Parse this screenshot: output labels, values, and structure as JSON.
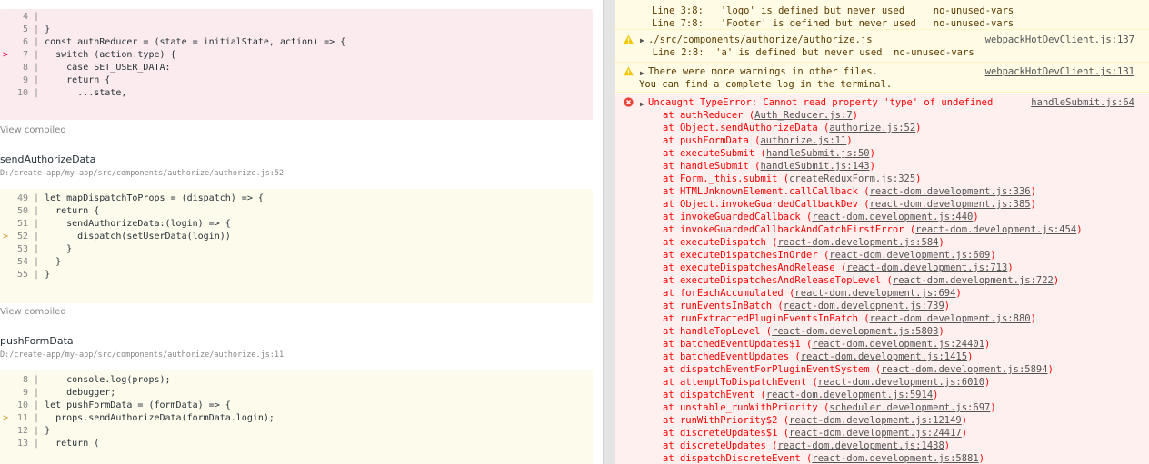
{
  "left": {
    "block1": [
      {
        "arrow": "",
        "num": "4",
        "code": ""
      },
      {
        "arrow": "",
        "num": "5",
        "code": "}"
      },
      {
        "arrow": "",
        "num": "6",
        "code": "const authReducer = (state = initialState, action) => {"
      },
      {
        "arrow": ">",
        "num": "7",
        "code": "  switch (action.type) {"
      },
      {
        "arrow": "",
        "num": "8",
        "code": "    case SET_USER_DATA:"
      },
      {
        "arrow": "",
        "num": "9",
        "code": "    return {"
      },
      {
        "arrow": "",
        "num": "10",
        "code": "      ...state,"
      }
    ],
    "view_compiled_1": "View compiled",
    "fn2_name": "sendAuthorizeData",
    "fn2_path": "D:/create-app/my-app/src/components/authorize/authorize.js:52",
    "block2": [
      {
        "arrow": "",
        "num": "49",
        "code": "let mapDispatchToProps = (dispatch) => {"
      },
      {
        "arrow": "",
        "num": "50",
        "code": "  return {"
      },
      {
        "arrow": "",
        "num": "51",
        "code": "    sendAuthorizeData:(login) => {"
      },
      {
        "arrow": ">",
        "num": "52",
        "code": "      dispatch(setUserData(login))"
      },
      {
        "arrow": "",
        "num": "53",
        "code": "    }"
      },
      {
        "arrow": "",
        "num": "54",
        "code": "  }"
      },
      {
        "arrow": "",
        "num": "55",
        "code": "}"
      }
    ],
    "view_compiled_2": "View compiled",
    "fn3_name": "pushFormData",
    "fn3_path": "D:/create-app/my-app/src/components/authorize/authorize.js:11",
    "block3": [
      {
        "arrow": "",
        "num": "8",
        "code": "    console.log(props);"
      },
      {
        "arrow": "",
        "num": "9",
        "code": "    debugger;"
      },
      {
        "arrow": "",
        "num": "10",
        "code": "let pushFormData = (formData) => {"
      },
      {
        "arrow": ">",
        "num": "11",
        "code": "  props.sendAuthorizeData(formData.login);"
      },
      {
        "arrow": "",
        "num": "12",
        "code": "}"
      },
      {
        "arrow": "",
        "num": "13",
        "code": "  return ("
      }
    ]
  },
  "console": {
    "warn_top": {
      "line1": "Line 3:8:   'logo' is defined but never used     no-unused-vars",
      "line2": "Line 7:8:   'Footer' is defined but never used   no-unused-vars"
    },
    "warn_authorize": {
      "title": "./src/components/authorize/authorize.js",
      "source": "webpackHotDevClient.js:137",
      "detail": "  Line 2:8:  'a' is defined but never used  no-unused-vars"
    },
    "warn_more": {
      "title": "There were more warnings in other files.",
      "source": "webpackHotDevClient.js:131",
      "detail": "You can find a complete log in the terminal."
    },
    "error": {
      "title": "Uncaught TypeError: Cannot read property 'type' of undefined",
      "source": "handleSubmit.js:64",
      "frames": [
        {
          "fn": "at authReducer",
          "loc": "Auth_Reducer.js:7"
        },
        {
          "fn": "at Object.sendAuthorizeData",
          "loc": "authorize.js:52"
        },
        {
          "fn": "at pushFormData",
          "loc": "authorize.js:11"
        },
        {
          "fn": "at executeSubmit",
          "loc": "handleSubmit.js:50"
        },
        {
          "fn": "at handleSubmit",
          "loc": "handleSubmit.js:143"
        },
        {
          "fn": "at Form._this.submit",
          "loc": "createReduxForm.js:325"
        },
        {
          "fn": "at HTMLUnknownElement.callCallback",
          "loc": "react-dom.development.js:336"
        },
        {
          "fn": "at Object.invokeGuardedCallbackDev",
          "loc": "react-dom.development.js:385"
        },
        {
          "fn": "at invokeGuardedCallback",
          "loc": "react-dom.development.js:440"
        },
        {
          "fn": "at invokeGuardedCallbackAndCatchFirstError",
          "loc": "react-dom.development.js:454"
        },
        {
          "fn": "at executeDispatch",
          "loc": "react-dom.development.js:584"
        },
        {
          "fn": "at executeDispatchesInOrder",
          "loc": "react-dom.development.js:609"
        },
        {
          "fn": "at executeDispatchesAndRelease",
          "loc": "react-dom.development.js:713"
        },
        {
          "fn": "at executeDispatchesAndReleaseTopLevel",
          "loc": "react-dom.development.js:722"
        },
        {
          "fn": "at forEachAccumulated",
          "loc": "react-dom.development.js:694"
        },
        {
          "fn": "at runEventsInBatch",
          "loc": "react-dom.development.js:739"
        },
        {
          "fn": "at runExtractedPluginEventsInBatch",
          "loc": "react-dom.development.js:880"
        },
        {
          "fn": "at handleTopLevel",
          "loc": "react-dom.development.js:5803"
        },
        {
          "fn": "at batchedEventUpdates$1",
          "loc": "react-dom.development.js:24401"
        },
        {
          "fn": "at batchedEventUpdates",
          "loc": "react-dom.development.js:1415"
        },
        {
          "fn": "at dispatchEventForPluginEventSystem",
          "loc": "react-dom.development.js:5894"
        },
        {
          "fn": "at attemptToDispatchEvent",
          "loc": "react-dom.development.js:6010"
        },
        {
          "fn": "at dispatchEvent",
          "loc": "react-dom.development.js:5914"
        },
        {
          "fn": "at unstable_runWithPriority",
          "loc": "scheduler.development.js:697"
        },
        {
          "fn": "at runWithPriority$2",
          "loc": "react-dom.development.js:12149"
        },
        {
          "fn": "at discreteUpdates$1",
          "loc": "react-dom.development.js:24417"
        },
        {
          "fn": "at discreteUpdates",
          "loc": "react-dom.development.js:1438"
        },
        {
          "fn": "at dispatchDiscreteEvent",
          "loc": "react-dom.development.js:5881"
        }
      ]
    }
  }
}
